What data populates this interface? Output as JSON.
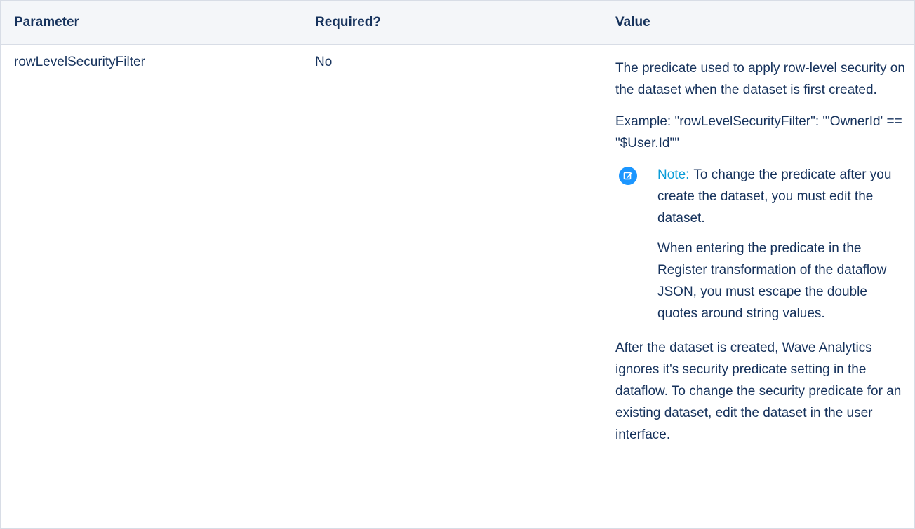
{
  "table": {
    "headers": {
      "parameter": "Parameter",
      "required": "Required?",
      "value": "Value"
    },
    "row": {
      "parameter": "rowLevelSecurityFilter",
      "required": "No",
      "value": {
        "description": "The predicate used to apply row-level security on the dataset when the dataset is first created.",
        "example": "Example: \"rowLevelSecurityFilter\": \"'OwnerId' == \"$User.Id\"\"",
        "note": {
          "icon": "edit-note-icon",
          "label": "Note:",
          "text_1": "To change the predicate after you create the dataset, you must edit the dataset.",
          "text_2": "When entering the predicate in the Register transformation of the dataflow JSON, you must escape the double quotes around string values."
        },
        "after": "After the dataset is created, Wave Analytics ignores it's security predicate setting in the dataflow. To change the security predicate for an existing dataset, edit the dataset in the user interface."
      }
    }
  },
  "colors": {
    "text": "#16325c",
    "header_bg": "#f4f6f9",
    "border": "#d8dde6",
    "note_accent": "#0a9cd8",
    "note_icon_bg": "#1b96ff"
  }
}
